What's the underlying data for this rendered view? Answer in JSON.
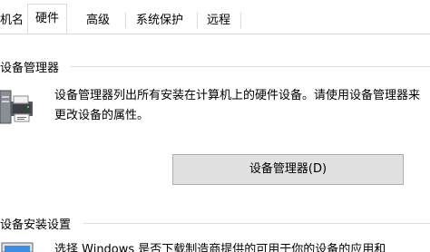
{
  "tabs": [
    {
      "label": "机名"
    },
    {
      "label": "硬件"
    },
    {
      "label": "高级"
    },
    {
      "label": "系统保护"
    },
    {
      "label": "远程"
    }
  ],
  "active_tab": "硬件",
  "device_manager_group": {
    "title": "设备管理器",
    "description": "设备管理器列出所有安装在计算机上的硬件设备。请使用设备管理器来更改设备的属性。",
    "button_label": "设备管理器(D)"
  },
  "install_settings_group": {
    "title": "设备安装设置",
    "description": "选择 Windows 是否下载制造商提供的可用于你的设备的应用和"
  },
  "icons": {
    "device_manager": "computer-with-printer-icon",
    "install_settings": "computer-monitor-icon"
  },
  "colors": {
    "background": "#ffffff",
    "border": "#d9d9d9",
    "button_face": "#e1e1e1",
    "button_border": "#adadad"
  }
}
